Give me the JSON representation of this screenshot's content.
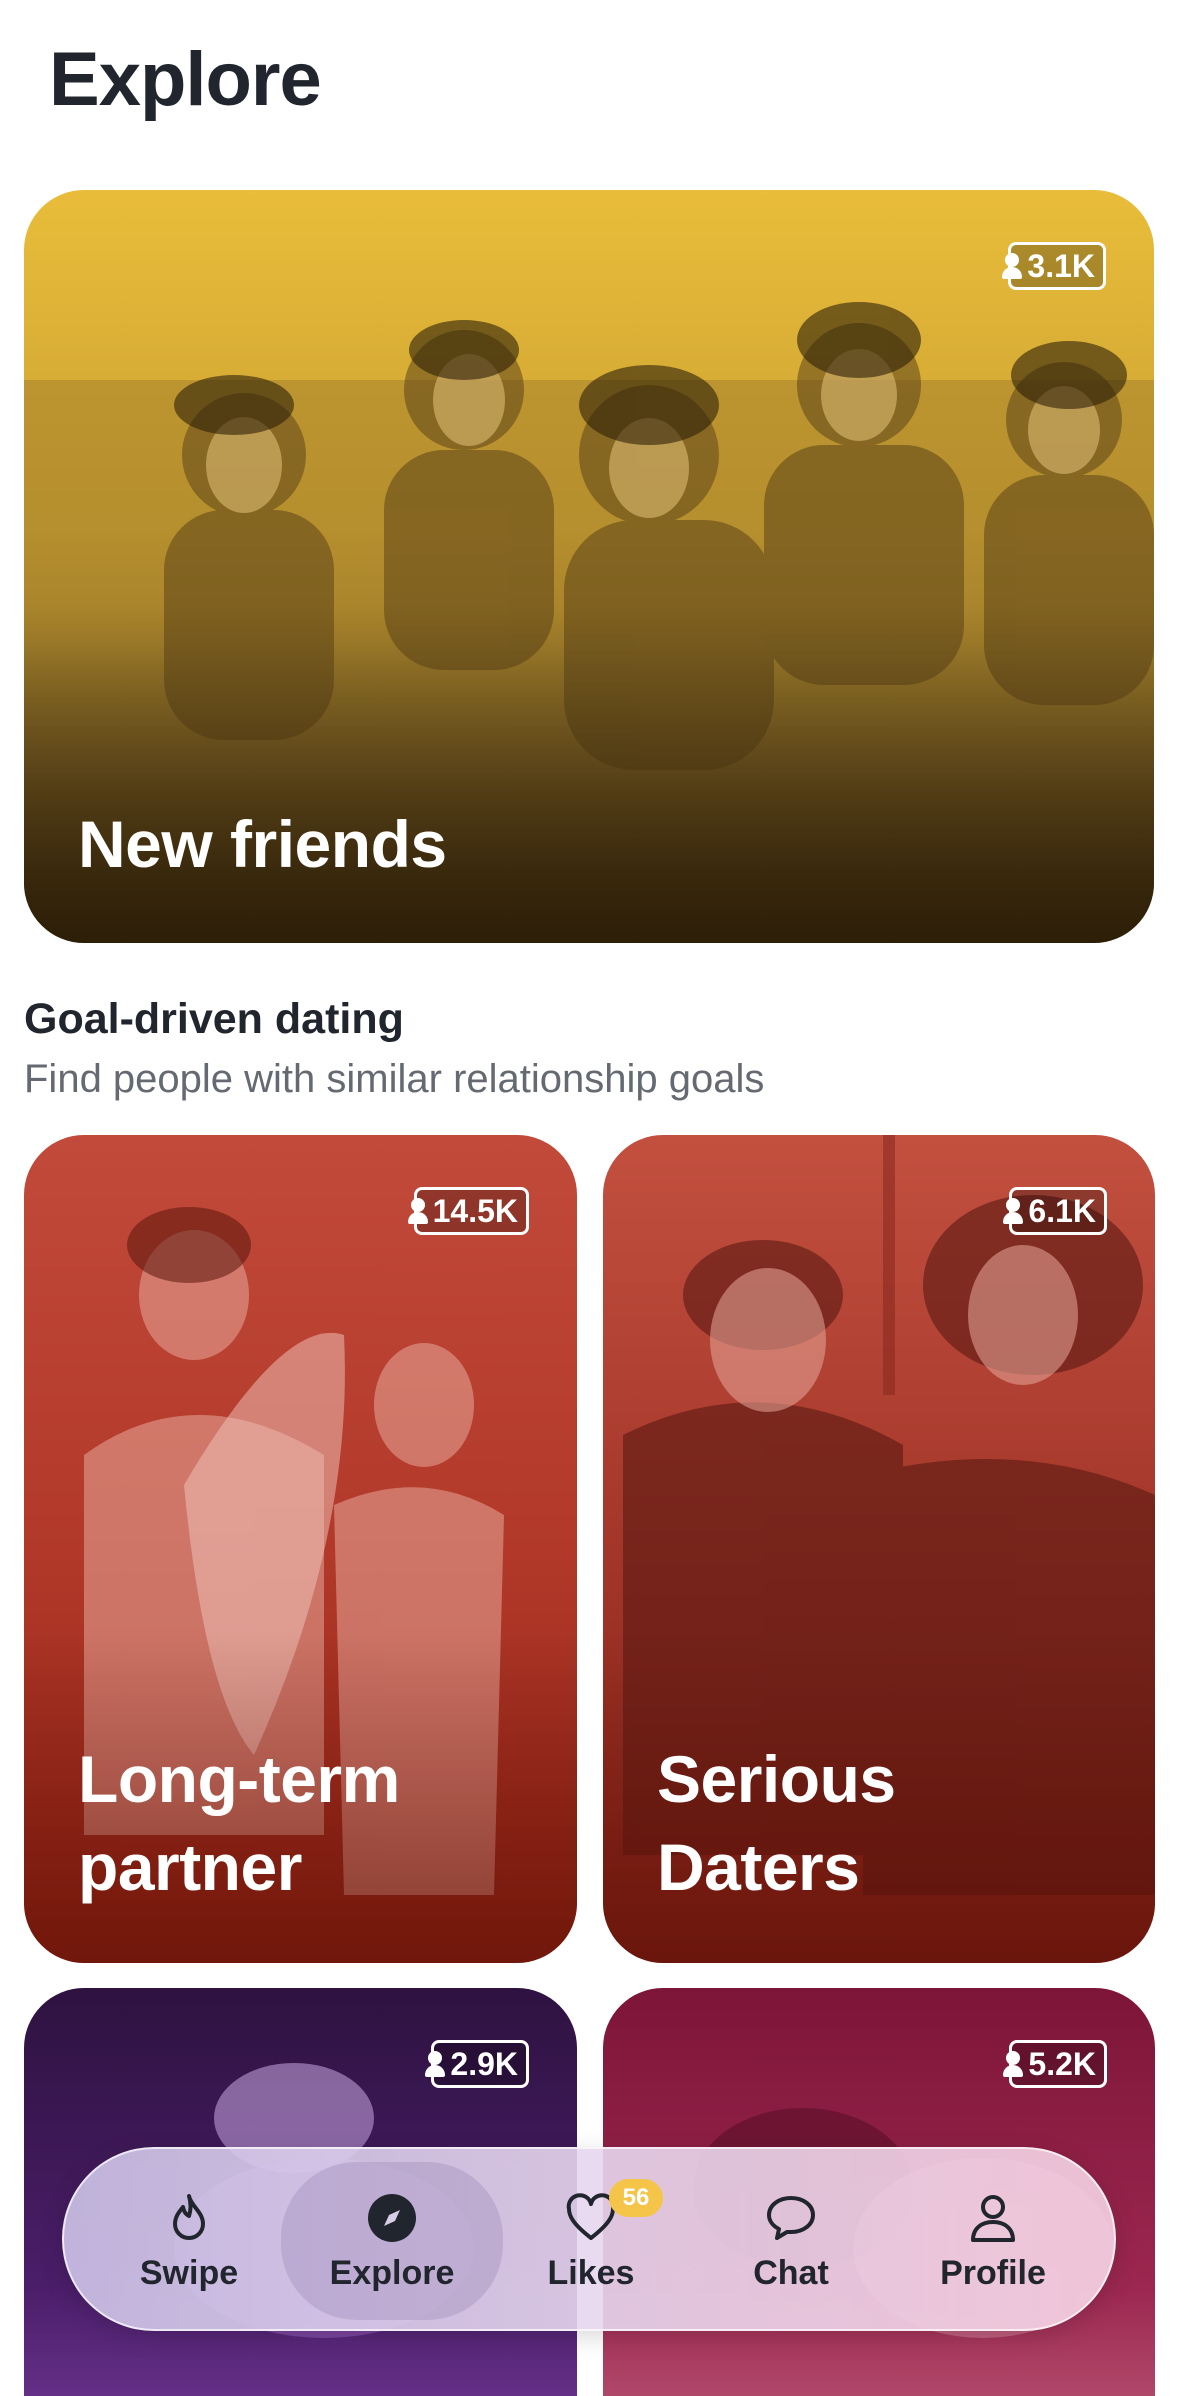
{
  "header": {
    "title": "Explore"
  },
  "featured": {
    "label": "New friends",
    "count": "3.1K"
  },
  "goal_section": {
    "title": "Goal-driven dating",
    "subtitle": "Find people with similar relationship goals",
    "cards": [
      {
        "label": "Long-term partner",
        "count": "14.5K"
      },
      {
        "label": "Serious Daters",
        "count": "6.1K"
      },
      {
        "label": "",
        "count": "2.9K"
      },
      {
        "label": "",
        "count": "5.2K"
      }
    ]
  },
  "nav": {
    "items": [
      {
        "label": "Swipe",
        "icon": "flame-icon"
      },
      {
        "label": "Explore",
        "icon": "compass-icon",
        "active": true
      },
      {
        "label": "Likes",
        "icon": "heart-icon",
        "badge": "56"
      },
      {
        "label": "Chat",
        "icon": "chat-bubble-icon"
      },
      {
        "label": "Profile",
        "icon": "person-icon"
      }
    ]
  },
  "colors": {
    "title": "#21252d",
    "subtitle": "#656a72",
    "featured": "#e9bd3a",
    "goal_red": "#b2392a",
    "likes_badge": "#f5c54a"
  }
}
